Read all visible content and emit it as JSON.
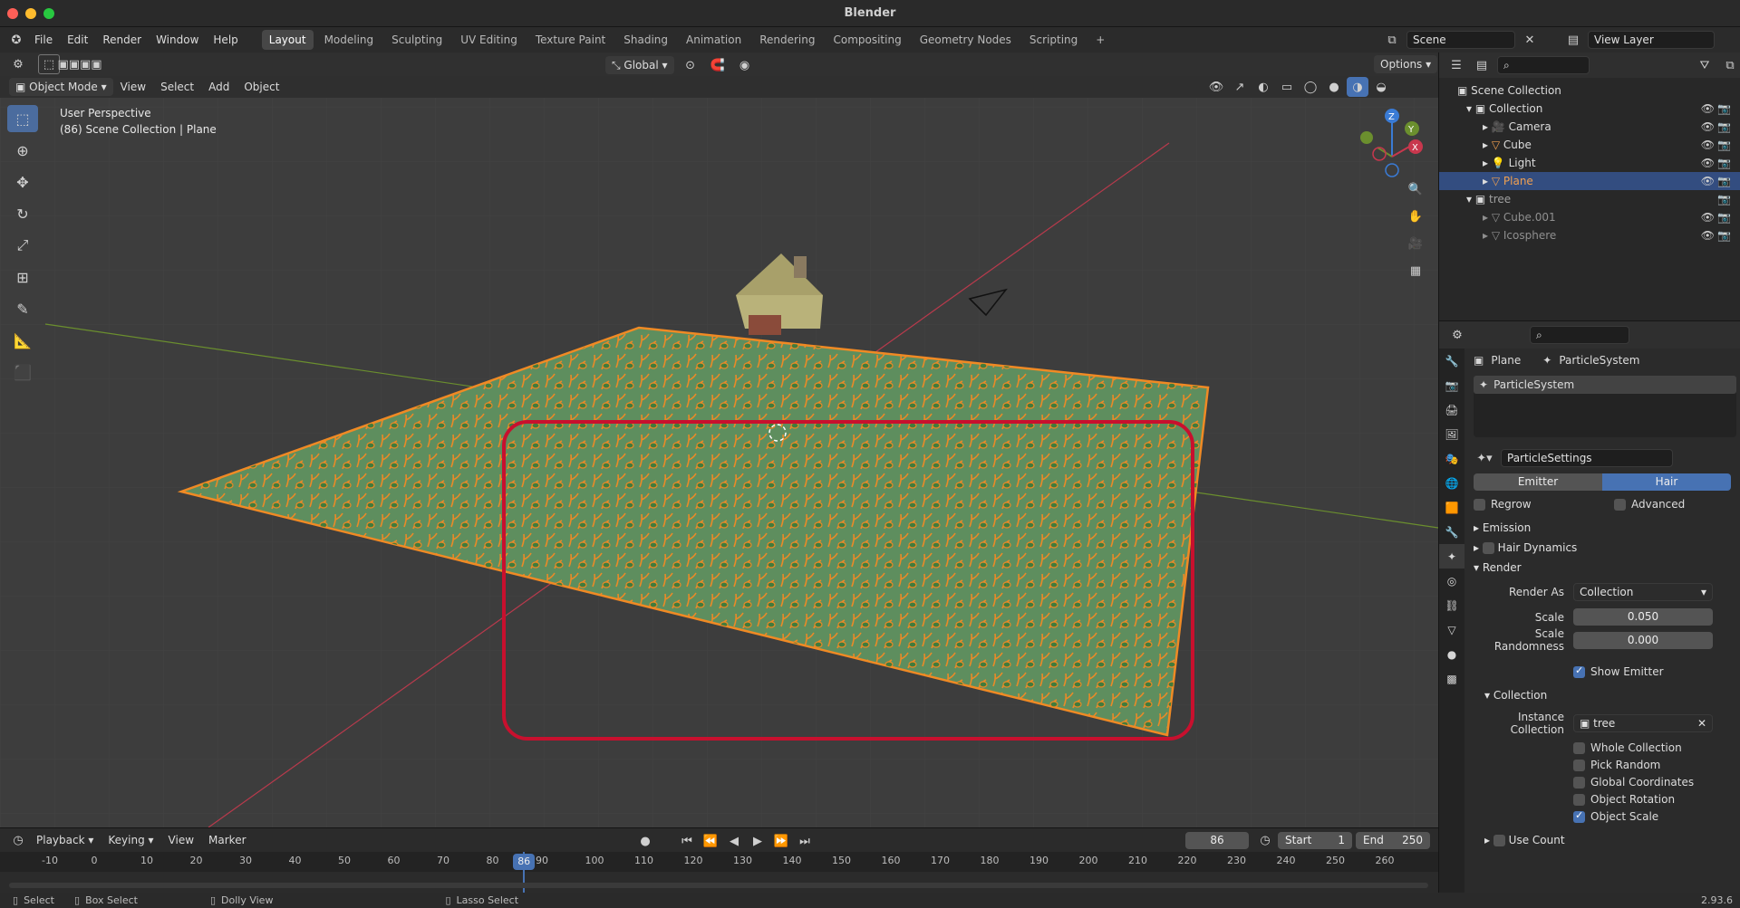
{
  "window": {
    "title": "Blender"
  },
  "menu": {
    "items": [
      "File",
      "Edit",
      "Render",
      "Window",
      "Help"
    ]
  },
  "workspaces": {
    "tabs": [
      "Layout",
      "Modeling",
      "Sculpting",
      "UV Editing",
      "Texture Paint",
      "Shading",
      "Animation",
      "Rendering",
      "Compositing",
      "Geometry Nodes",
      "Scripting"
    ],
    "active": "Layout"
  },
  "scene": {
    "name": "Scene",
    "view_layer": "View Layer"
  },
  "viewport": {
    "mode": "Object Mode",
    "menus": [
      "View",
      "Select",
      "Add",
      "Object"
    ],
    "orientation": "Global",
    "options_label": "Options",
    "info_line1": "User Perspective",
    "info_line2": "(86) Scene Collection | Plane",
    "gizmo_axes": {
      "z": "Z",
      "y": "Y",
      "x": "X"
    },
    "colors": {
      "highlight_rect": "#c8102e",
      "plane": "#5e8e5e",
      "hair": "#f08a24",
      "x_axis": "#b83a4c",
      "y_axis": "#6b8f2e"
    }
  },
  "outliner": {
    "root": "Scene Collection",
    "items": [
      {
        "label": "Collection",
        "level": 1
      },
      {
        "label": "Camera",
        "level": 2
      },
      {
        "label": "Cube",
        "level": 2
      },
      {
        "label": "Light",
        "level": 2
      },
      {
        "label": "Plane",
        "level": 2,
        "selected": true
      },
      {
        "label": "tree",
        "level": 1
      },
      {
        "label": "Cube.001",
        "level": 2
      },
      {
        "label": "Icosphere",
        "level": 2
      }
    ]
  },
  "properties": {
    "breadcrumb_object": "Plane",
    "breadcrumb_system": "ParticleSystem",
    "system_list_item": "ParticleSystem",
    "settings_name": "ParticleSettings",
    "type_emitter": "Emitter",
    "type_hair": "Hair",
    "regrow": "Regrow",
    "advanced": "Advanced",
    "panel_emission": "Emission",
    "panel_hair_dynamics": "Hair Dynamics",
    "panel_render": "Render",
    "render_as_label": "Render As",
    "render_as_value": "Collection",
    "scale_label": "Scale",
    "scale_value": "0.050",
    "scale_rand_label": "Scale Randomness",
    "scale_rand_value": "0.000",
    "show_emitter": "Show Emitter",
    "sub_collection": "Collection",
    "instance_collection_label": "Instance Collection",
    "instance_collection_value": "tree",
    "whole_collection": "Whole Collection",
    "pick_random": "Pick Random",
    "global_coordinates": "Global Coordinates",
    "object_rotation": "Object Rotation",
    "object_scale": "Object Scale",
    "use_count": "Use Count"
  },
  "timeline": {
    "menus": [
      "Playback",
      "Keying",
      "View",
      "Marker"
    ],
    "current_frame": "86",
    "start_label": "Start",
    "start_value": "1",
    "end_label": "End",
    "end_value": "250",
    "ticks": [
      "-10",
      "0",
      "10",
      "20",
      "30",
      "40",
      "50",
      "60",
      "70",
      "80",
      "90",
      "100",
      "110",
      "120",
      "130",
      "140",
      "150",
      "160",
      "170",
      "180",
      "190",
      "200",
      "210",
      "220",
      "230",
      "240",
      "250",
      "260"
    ]
  },
  "statusbar": {
    "select": "Select",
    "box_select": "Box Select",
    "dolly_view": "Dolly View",
    "lasso_select": "Lasso Select",
    "version": "2.93.6"
  }
}
